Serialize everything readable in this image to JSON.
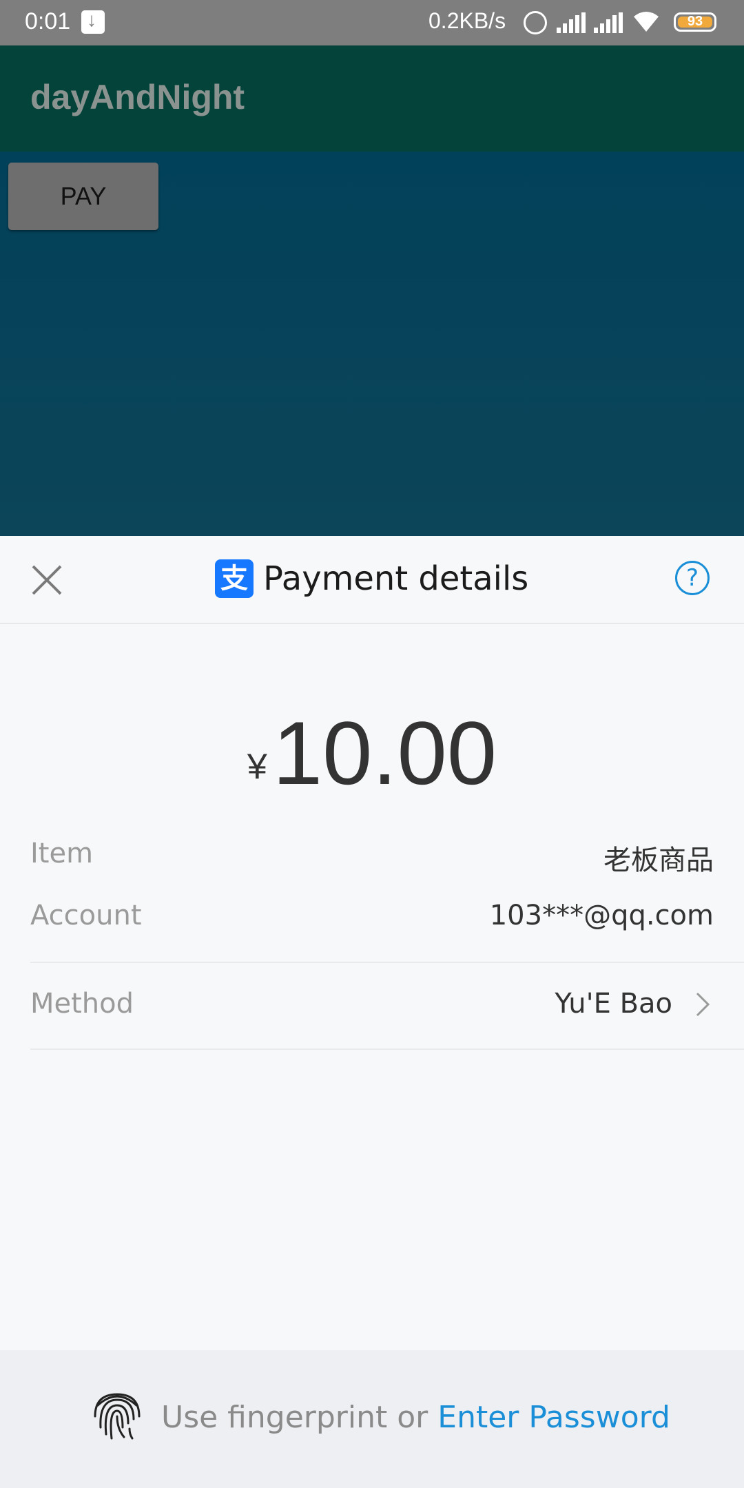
{
  "status_bar": {
    "time": "0:01",
    "network_speed": "0.2KB/s",
    "battery": "93",
    "icons": [
      "download-icon",
      "alarm-icon",
      "signal-icon",
      "signal-icon",
      "wifi-icon",
      "battery-icon"
    ]
  },
  "app_bar": {
    "title": "dayAndNight"
  },
  "main": {
    "pay_button_label": "PAY"
  },
  "payment_sheet": {
    "title": "Payment details",
    "currency_symbol": "¥",
    "amount": "10.00",
    "item_label": "Item",
    "item_value": "老板商品",
    "account_label": "Account",
    "account_value": "103***@qq.com",
    "method_label": "Method",
    "method_value": "Yu'E Bao",
    "footer_text": "Use fingerprint or",
    "footer_link": "Enter Password"
  },
  "colors": {
    "accent_blue": "#1a8fd8",
    "brand_blue": "#1678ff",
    "battery": "#f2a93b"
  }
}
